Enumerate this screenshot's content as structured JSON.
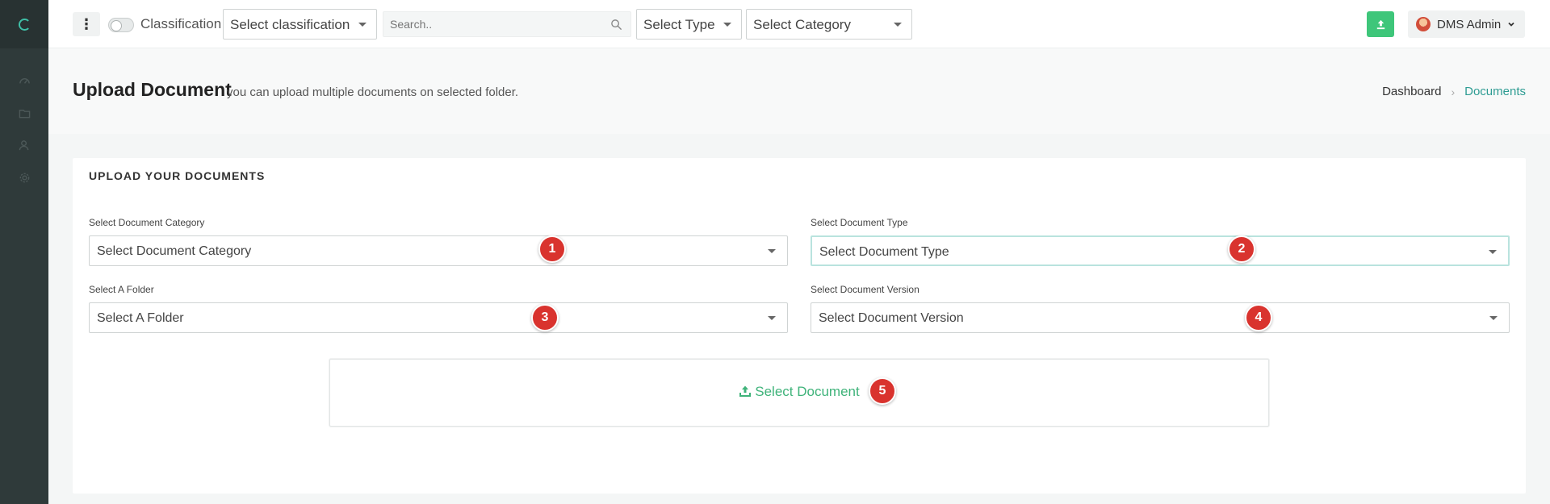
{
  "topbar": {
    "toggle_label": "Classification",
    "classification_select": "Select classification",
    "search_placeholder": "Search..",
    "type_select": "Select Type",
    "category_select": "Select Category",
    "user_name": "DMS Admin"
  },
  "header": {
    "title": "Upload Document",
    "subtitle": "you can upload multiple documents on selected folder.",
    "breadcrumb": [
      "Dashboard",
      "Documents"
    ]
  },
  "card": {
    "title": "UPLOAD YOUR DOCUMENTS",
    "category": {
      "label": "Select Document Category",
      "value": "Select Document Category",
      "badge": "1"
    },
    "type": {
      "label": "Select Document Type",
      "value": "Select Document Type",
      "badge": "2"
    },
    "folder": {
      "label": "Select A Folder",
      "value": "Select A Folder",
      "badge": "3"
    },
    "version": {
      "label": "Select Document Version",
      "value": "Select Document Version",
      "badge": "4"
    },
    "select_document": {
      "label": "Select Document",
      "badge": "5"
    }
  },
  "colors": {
    "accent": "#2e9c93",
    "upload_green": "#3ec67a",
    "badge_red": "#d9332e",
    "sidebar": "#2f3a3a"
  }
}
